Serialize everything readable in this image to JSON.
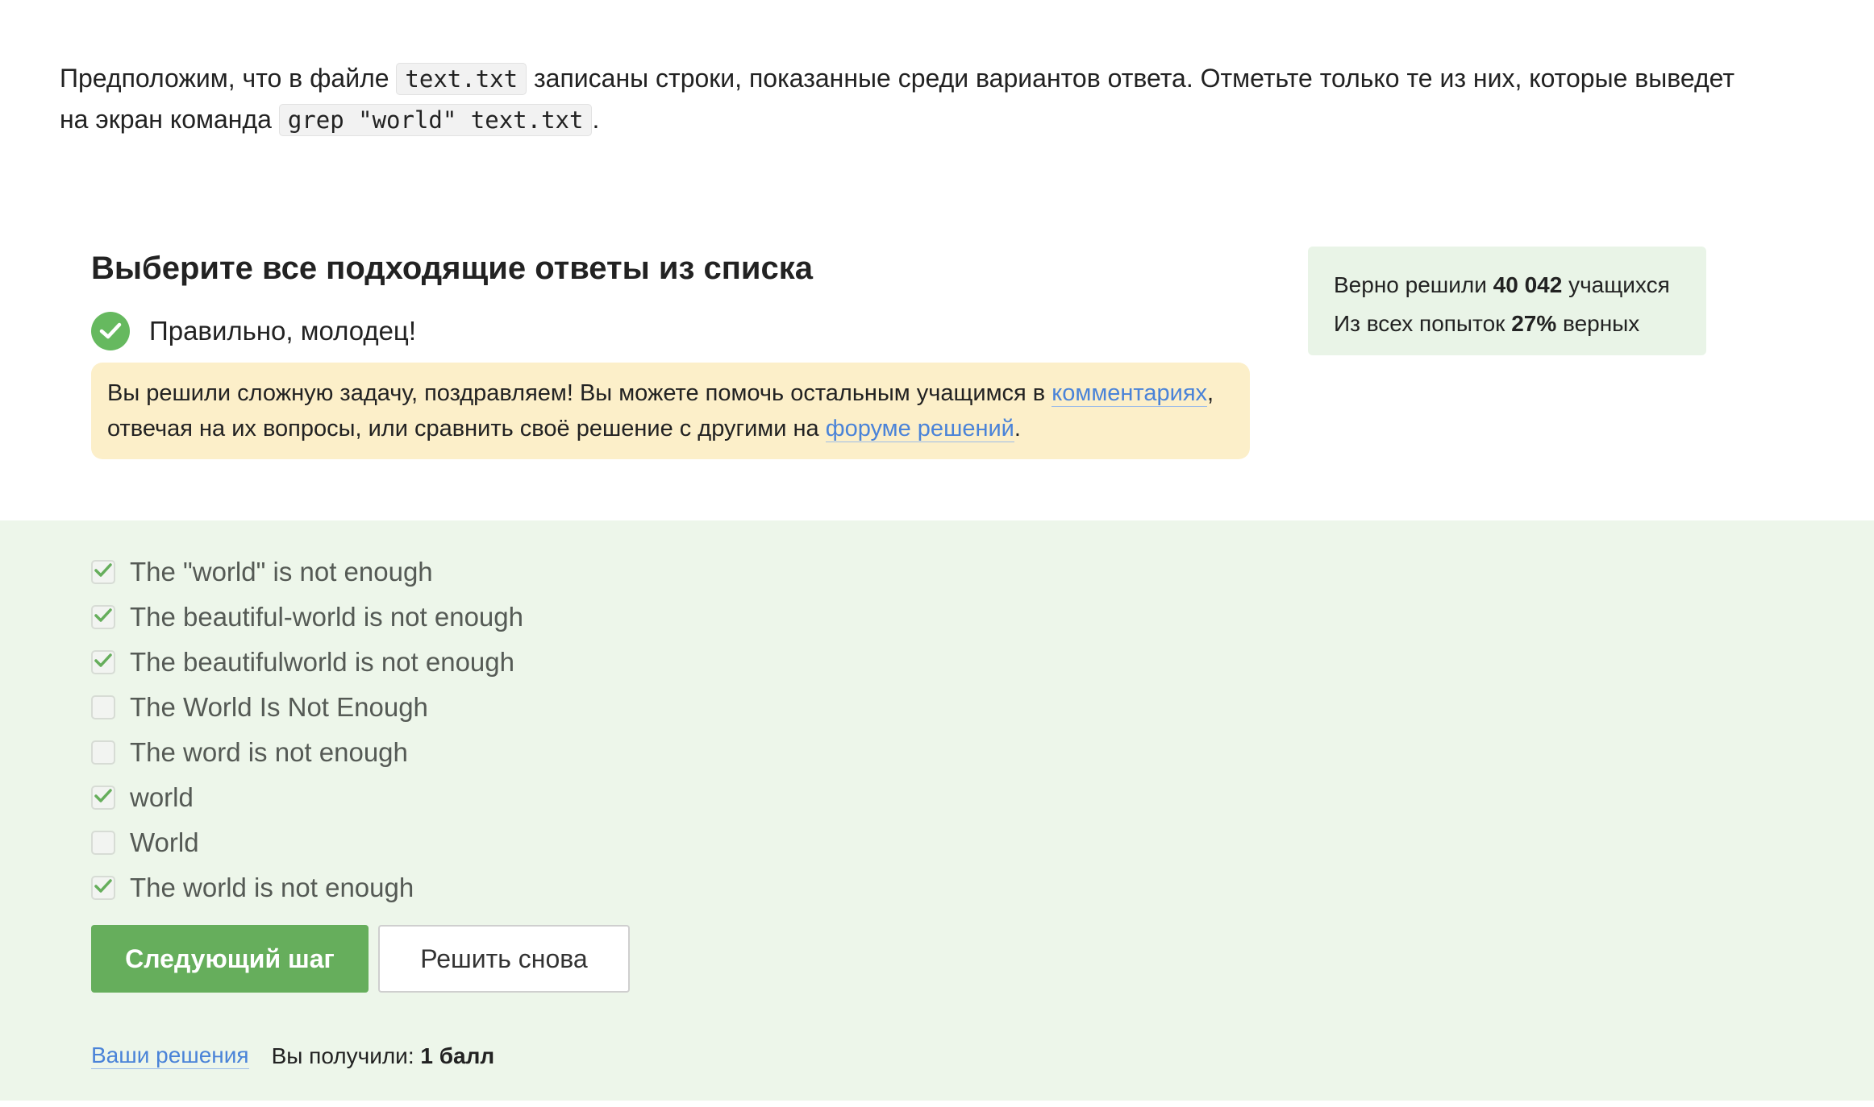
{
  "question": {
    "part1": "Предположим, что в файле",
    "code1": "text.txt",
    "part2": "записаны строки, показанные среди вариантов ответа. Отметьте только те из них, которые выведет на экран команда",
    "code2": "grep \"world\" text.txt",
    "part3": "."
  },
  "section": {
    "title": "Выберите все подходящие ответы из списка",
    "result_text": "Правильно, молодец!"
  },
  "notice": {
    "text1": "Вы решили сложную задачу, поздравляем! Вы можете помочь остальным учащимся в",
    "link1": "комментариях",
    "text2": ", отвечая на их вопросы, или сравнить своё решение с другими на",
    "link2": "форуме решений",
    "text3": "."
  },
  "stats": {
    "solved_prefix": "Верно решили",
    "solved_count": "40 042",
    "solved_suffix": "учащихся",
    "attempts_prefix": "Из всех попыток",
    "attempts_percent": "27%",
    "attempts_suffix": "верных"
  },
  "options": [
    {
      "label": "The \"world\" is not enough",
      "checked": true
    },
    {
      "label": "The beautiful-world is not enough",
      "checked": true
    },
    {
      "label": "The beautifulworld is not enough",
      "checked": true
    },
    {
      "label": "The World Is Not Enough",
      "checked": false
    },
    {
      "label": "The word is not enough",
      "checked": false
    },
    {
      "label": "world",
      "checked": true
    },
    {
      "label": "World",
      "checked": false
    },
    {
      "label": "The world is not enough",
      "checked": true
    }
  ],
  "buttons": {
    "next_label": "Следующий шаг",
    "retry_label": "Решить снова"
  },
  "footer": {
    "solutions_link": "Ваши решения",
    "score_prefix": "Вы получили:",
    "score_value": "1 балл"
  },
  "colors": {
    "accent_green": "#66ae5c",
    "panel_green": "#edf6ea",
    "notice_yellow": "#fcefc9",
    "link_blue": "#4a83d8"
  }
}
